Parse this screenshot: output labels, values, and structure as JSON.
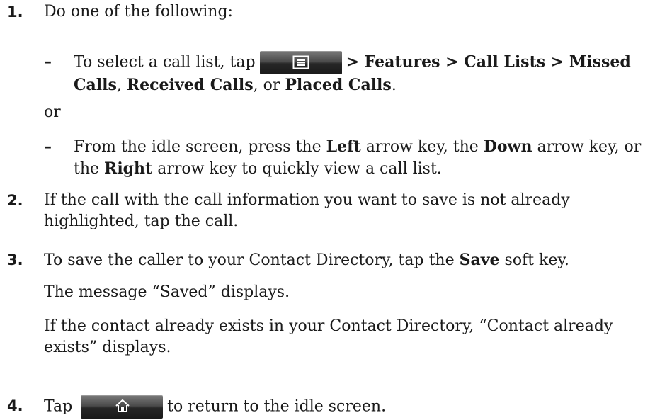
{
  "steps": [
    {
      "num": "1.",
      "intro": "Do one of the following:"
    },
    {
      "num": "2.",
      "text": "If the call with the call information you want to save is not already highlighted, tap the call."
    },
    {
      "num": "3.",
      "text_before": "To save the caller to your Contact Directory, tap the ",
      "bold": "Save",
      "text_after": " soft key."
    },
    {
      "num": "4.",
      "before": "Tap",
      "after": "to return to the idle screen."
    }
  ],
  "bullet1": {
    "dash": "–",
    "t1": "To select a call list, tap",
    "b1": "> Features > Call Lists > Missed Calls",
    "t2": ", ",
    "b2": "Received Calls",
    "t3": ", or ",
    "b3": "Placed Calls",
    "t4": "."
  },
  "or_text": "or",
  "bullet2": {
    "dash": "–",
    "t1": "From the idle screen, press the ",
    "b1": "Left",
    "t2": " arrow key, the ",
    "b2": "Down",
    "t3": " arrow key, or the ",
    "b3": "Right",
    "t4": " arrow key to quickly view a call list."
  },
  "saved_message": "The message “Saved” displays.",
  "exists_message": "If the contact already exists in your Contact Directory, “Contact already exists” displays.",
  "icons": {
    "menu": "menu-icon",
    "home": "home-icon"
  }
}
